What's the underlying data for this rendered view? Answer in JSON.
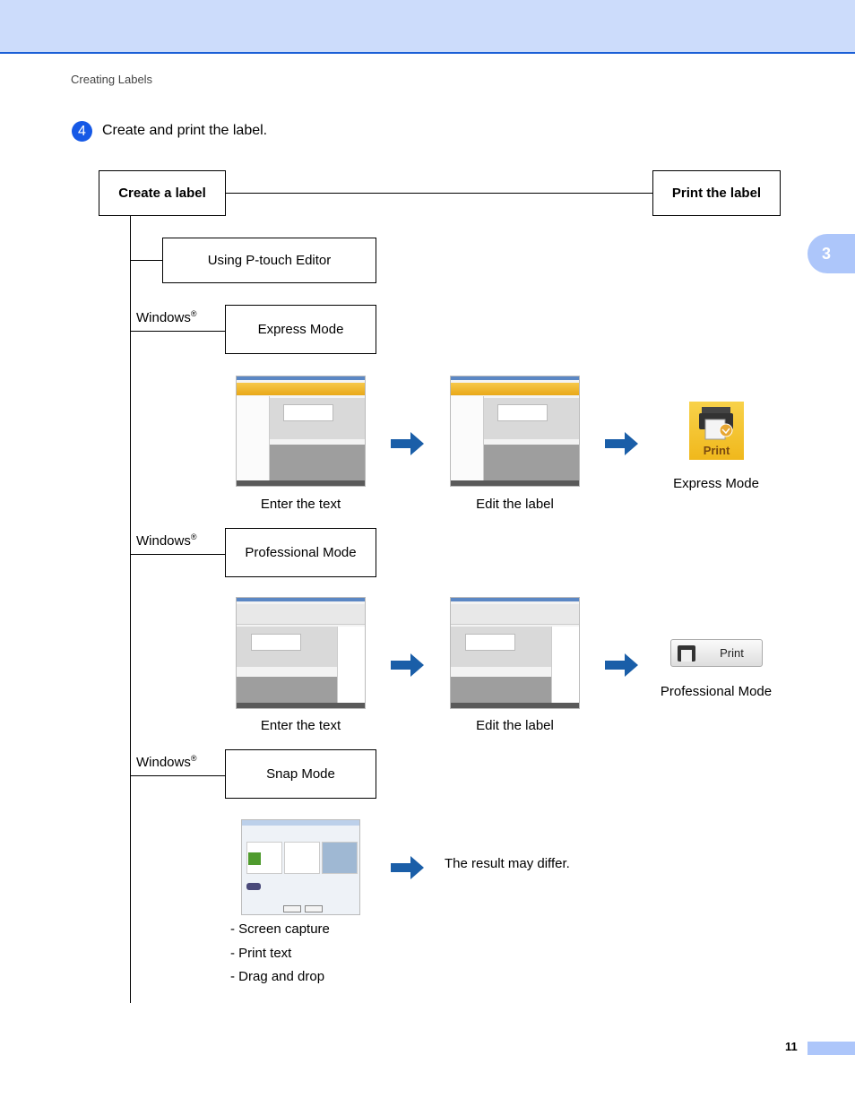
{
  "header": {
    "section_title": "Creating Labels"
  },
  "chapter_tab": "3",
  "step": {
    "number": "4",
    "text": "Create and print the label."
  },
  "flow": {
    "create_label": "Create a label",
    "print_label": "Print the label",
    "using_editor": "Using P-touch Editor",
    "os_label": "Windows",
    "os_mark": "®",
    "modes": [
      {
        "name": "Express Mode",
        "screens": [
          "Enter the text",
          "Edit the label"
        ],
        "print_button": "Print",
        "print_caption": "Express Mode"
      },
      {
        "name": "Professional Mode",
        "screens": [
          "Enter the text",
          "Edit the label"
        ],
        "print_button": "Print",
        "print_caption": "Professional Mode"
      },
      {
        "name": "Snap Mode",
        "result_note": "The result may differ.",
        "features": [
          "- Screen capture",
          "- Print text",
          "- Drag and drop"
        ]
      }
    ]
  },
  "footer": {
    "page_number": "11"
  },
  "colors": {
    "accent_blue": "#1659e6",
    "header_band": "#ccdcfb",
    "tab_blue": "#adc6fa",
    "arrow_blue": "#1a5ea8",
    "print_yellow": "#f5c530"
  }
}
